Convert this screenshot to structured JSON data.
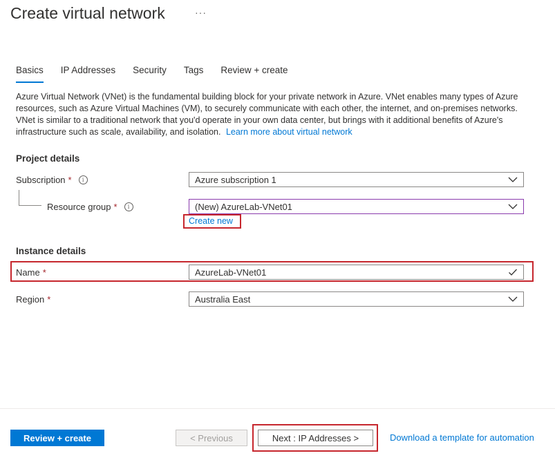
{
  "page": {
    "title": "Create virtual network",
    "more": "···"
  },
  "tabs": [
    {
      "label": "Basics",
      "active": true
    },
    {
      "label": "IP Addresses"
    },
    {
      "label": "Security"
    },
    {
      "label": "Tags"
    },
    {
      "label": "Review + create"
    }
  ],
  "description": {
    "text": "Azure Virtual Network (VNet) is the fundamental building block for your private network in Azure. VNet enables many types of Azure resources, such as Azure Virtual Machines (VM), to securely communicate with each other, the internet, and on-premises networks. VNet is similar to a traditional network that you'd operate in your own data center, but brings with it additional benefits of Azure's infrastructure such as scale, availability, and isolation.",
    "link": "Learn more about virtual network"
  },
  "project_details": {
    "heading": "Project details",
    "subscription": {
      "label": "Subscription",
      "required": "*",
      "info": "i",
      "value": "Azure subscription 1"
    },
    "resource_group": {
      "label": "Resource group",
      "required": "*",
      "info": "i",
      "value": "(New) AzureLab-VNet01",
      "create_new": "Create new"
    }
  },
  "instance_details": {
    "heading": "Instance details",
    "name": {
      "label": "Name",
      "required": "*",
      "value": "AzureLab-VNet01"
    },
    "region": {
      "label": "Region",
      "required": "*",
      "value": "Australia East"
    }
  },
  "footer": {
    "review_create": "Review + create",
    "previous": "< Previous",
    "next": "Next : IP Addresses >",
    "download_link": "Download a template for automation"
  },
  "colors": {
    "accent": "#0078d4",
    "highlight": "#c6262d",
    "required": "#a4262c"
  },
  "icons": {
    "dropdown": "chevron-down-icon",
    "valid": "checkmark-icon",
    "info": "info-icon"
  }
}
